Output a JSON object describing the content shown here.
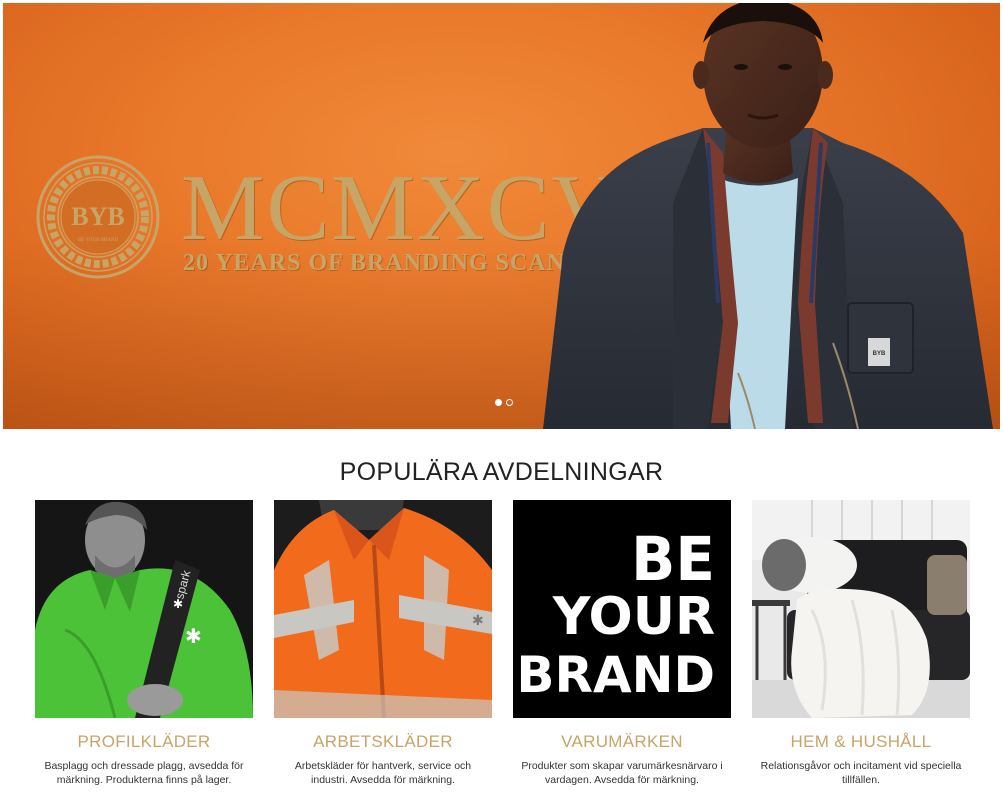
{
  "hero": {
    "logo_monogram": "BYB",
    "logo_subtext": "BE YOUR BRAND",
    "roman_numerals": "MCMXCVIII",
    "tagline": "20 YEARS OF BRANDING SCANDINAVIA",
    "badge_text": "BYB",
    "slides": {
      "count": 2,
      "active_index": 0
    },
    "colors": {
      "background": "#ea7a2c",
      "gold": "#c6a566"
    }
  },
  "section": {
    "title": "POPULÄRA AVDELNINGAR"
  },
  "categories": [
    {
      "name": "PROFILKLÄDER",
      "description": "Basplagg och dressade plagg, avsedda för märkning. Produkterna finns på lager.",
      "image": "green-jacket-man",
      "brand_text": "spark"
    },
    {
      "name": "ARBETSKLÄDER",
      "description": "Arbetskläder för hantverk, service och industri. Avsedda för märkning.",
      "image": "hi-vis-orange-jacket"
    },
    {
      "name": "VARUMÄRKEN",
      "description": "Produkter som skapar varumärkesnärvaro i vardagen. Avsedda för märkning.",
      "image": "be-your-brand-text",
      "image_text": [
        "BE",
        "YOUR",
        "BRAND"
      ]
    },
    {
      "name": "HEM & HUSHÅLL",
      "description": "Relationsgåvor och incitament vid speciella tillfällen.",
      "image": "sofa-fur-throws"
    }
  ],
  "colors": {
    "category_name": "#c9a467"
  }
}
